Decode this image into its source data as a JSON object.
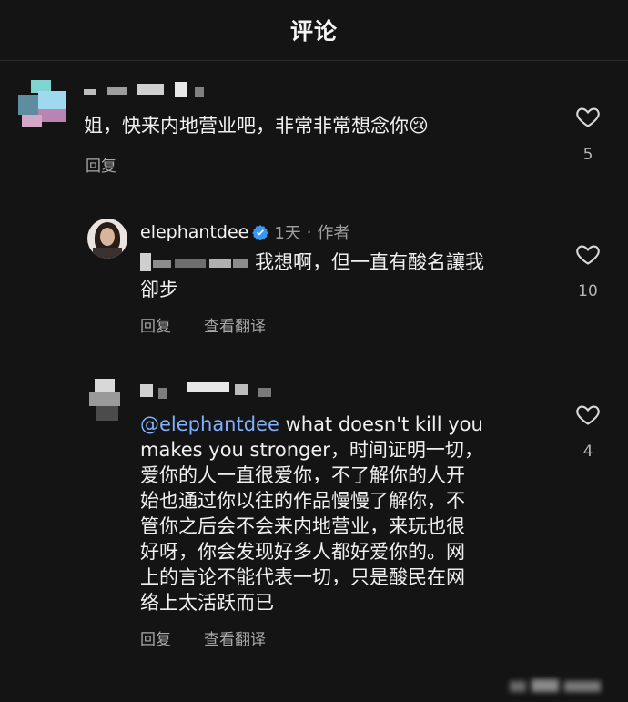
{
  "header": {
    "title": "评论"
  },
  "comments": [
    {
      "text": "姐，快来内地营业吧，非常非常想念你",
      "emoji": "😢",
      "reply_label": "回复",
      "likes": "5"
    },
    {
      "username": "elephantdee",
      "time": "1天",
      "separator": "·",
      "author_tag": "作者",
      "text_line1": "我想啊，但一直有酸名讓我",
      "text_line2": "卻步",
      "reply_label": "回复",
      "translate_label": "查看翻译",
      "likes": "10"
    },
    {
      "mention": "@elephantdee",
      "text_lines": [
        " what doesn't kill you",
        "makes you stronger，时间证明一切，",
        "爱你的人一直很爱你，不了解你的人开",
        "始也通过你以往的作品慢慢了解你，不",
        "管你之后会不会来内地营业，来玩也很",
        "好呀，你会发现好多人都好爱你的。网",
        "上的言论不能代表一切，只是酸民在网",
        "络上太活跃而已"
      ],
      "reply_label": "回复",
      "translate_label": "查看翻译",
      "likes": "4"
    }
  ],
  "colors": {
    "background": "#141414",
    "verified": "#3897f0",
    "mention": "#7fb0ff"
  }
}
